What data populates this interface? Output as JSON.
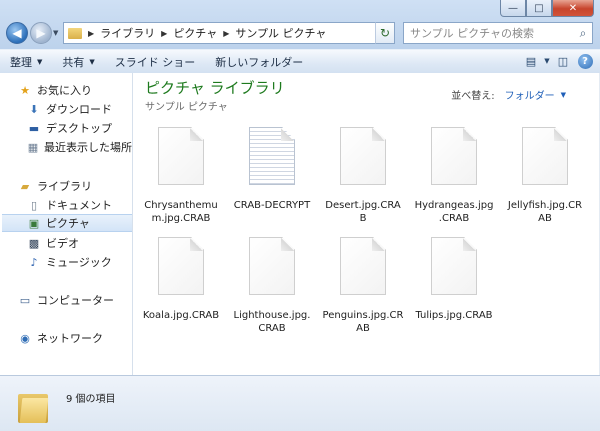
{
  "window": {
    "controls": {
      "minimize": "—",
      "maximize": "□",
      "close": "✕"
    }
  },
  "address": {
    "crumbs": [
      "ライブラリ",
      "ピクチャ",
      "サンプル ピクチャ"
    ],
    "search_placeholder": "サンプル ピクチャの検索"
  },
  "toolbar": {
    "organize": "整理",
    "share": "共有",
    "slideshow": "スライド ショー",
    "new_folder": "新しいフォルダー"
  },
  "sidebar": {
    "favorites": "お気に入り",
    "downloads": "ダウンロード",
    "desktop": "デスクトップ",
    "recent": "最近表示した場所",
    "libraries": "ライブラリ",
    "documents": "ドキュメント",
    "pictures": "ピクチャ",
    "videos": "ビデオ",
    "music": "ミュージック",
    "computer": "コンピューター",
    "network": "ネットワーク"
  },
  "main": {
    "title": "ピクチャ ライブラリ",
    "subtitle": "サンプル ピクチャ",
    "arrange_label": "並べ替え:",
    "arrange_value": "フォルダー",
    "files": [
      {
        "line1": "Chrysanthemu",
        "line2": "m.jpg.CRAB"
      },
      {
        "line1": "CRAB-DECRYPT",
        "line2": ""
      },
      {
        "line1": "Desert.jpg.CRA",
        "line2": "B"
      },
      {
        "line1": "Hydrangeas.jpg",
        "line2": ".CRAB"
      },
      {
        "line1": "Jellyfish.jpg.CR",
        "line2": "AB"
      },
      {
        "line1": "Koala.jpg.CRAB",
        "line2": ""
      },
      {
        "line1": "Lighthouse.jpg.",
        "line2": "CRAB"
      },
      {
        "line1": "Penguins.jpg.CR",
        "line2": "AB"
      },
      {
        "line1": "Tulips.jpg.CRAB",
        "line2": ""
      }
    ]
  },
  "details": {
    "count_text": "9 個の項目"
  },
  "colors": {
    "title_green": "#1e7a1e",
    "link_blue": "#1f5fb8",
    "selection": "#d3e4f7"
  },
  "icons": [
    "back-arrow-icon",
    "forward-arrow-icon",
    "folder-icon",
    "refresh-icon",
    "search-icon",
    "star-icon",
    "download-icon",
    "desktop-icon",
    "recent-places-icon",
    "library-icon",
    "documents-icon",
    "pictures-icon",
    "videos-icon",
    "music-icon",
    "computer-icon",
    "network-icon",
    "view-icon",
    "preview-pane-icon",
    "help-icon",
    "file-icon"
  ]
}
